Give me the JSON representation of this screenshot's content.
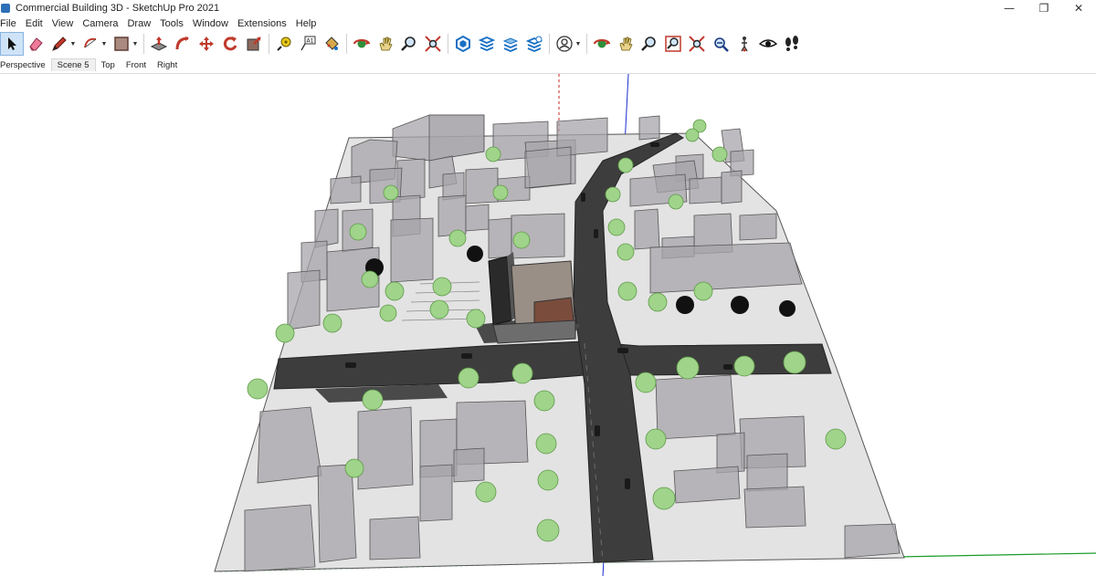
{
  "window": {
    "title": "Commercial Building 3D - SketchUp Pro 2021",
    "controls": [
      "minimize",
      "restore",
      "close"
    ]
  },
  "menu": [
    "File",
    "Edit",
    "View",
    "Camera",
    "Draw",
    "Tools",
    "Window",
    "Extensions",
    "Help"
  ],
  "toolbar": {
    "tools": [
      {
        "name": "select-tool",
        "icon": "arrow-cursor-icon",
        "active": true
      },
      {
        "name": "eraser-tool",
        "icon": "eraser-icon"
      },
      {
        "name": "line-tool",
        "icon": "pencil-icon",
        "dropdown": true
      },
      {
        "name": "arc-tool",
        "icon": "arc-icon",
        "dropdown": true
      },
      {
        "name": "shape-tool",
        "icon": "rectangle-icon",
        "dropdown": true
      },
      {
        "name": "push-pull-tool",
        "icon": "push-pull-icon"
      },
      {
        "name": "follow-me-tool",
        "icon": "follow-me-icon"
      },
      {
        "name": "move-tool",
        "icon": "move-icon"
      },
      {
        "name": "rotate-tool",
        "icon": "rotate-icon"
      },
      {
        "name": "scale-tool",
        "icon": "scale-icon"
      },
      {
        "name": "tape-measure-tool",
        "icon": "tape-measure-icon"
      },
      {
        "name": "text-tool",
        "icon": "text-icon"
      },
      {
        "name": "paint-bucket-tool",
        "icon": "paint-bucket-icon"
      },
      {
        "name": "orbit-tool",
        "icon": "orbit-icon"
      },
      {
        "name": "pan-tool",
        "icon": "hand-icon"
      },
      {
        "name": "zoom-tool",
        "icon": "magnifier-icon"
      },
      {
        "name": "zoom-extents-tool",
        "icon": "zoom-extents-icon"
      },
      {
        "name": "warehouse-button",
        "icon": "warehouse-icon"
      },
      {
        "name": "extension-warehouse-button",
        "icon": "extension-warehouse-icon"
      },
      {
        "name": "send-to-layout-button",
        "icon": "layout-icon"
      },
      {
        "name": "extension-manager-button",
        "icon": "extension-manager-icon"
      },
      {
        "name": "account-button",
        "icon": "user-icon",
        "dropdown": true
      },
      {
        "name": "orbit-tool-2",
        "icon": "orbit-icon"
      },
      {
        "name": "pan-tool-2",
        "icon": "hand-icon"
      },
      {
        "name": "zoom-tool-2",
        "icon": "magnifier-icon"
      },
      {
        "name": "zoom-window-tool",
        "icon": "zoom-window-icon"
      },
      {
        "name": "zoom-extents-tool-2",
        "icon": "zoom-extents-icon"
      },
      {
        "name": "previous-view-button",
        "icon": "previous-view-icon"
      },
      {
        "name": "position-camera-tool",
        "icon": "position-camera-icon"
      },
      {
        "name": "look-around-tool",
        "icon": "eye-icon"
      },
      {
        "name": "walk-tool",
        "icon": "footprints-icon"
      }
    ]
  },
  "scenes": [
    "Perspective",
    "Scene 5",
    "Top",
    "Front",
    "Right"
  ],
  "selected_scene": "Scene 5",
  "colors": {
    "accent": "#cfe3f7",
    "road": "#3d3d3d",
    "building": "#a7a4aa",
    "tree": "#9fd48a",
    "axis_blue": "#1c2fd1",
    "axis_green": "#1a9c2a",
    "axis_red": "#d02020"
  }
}
